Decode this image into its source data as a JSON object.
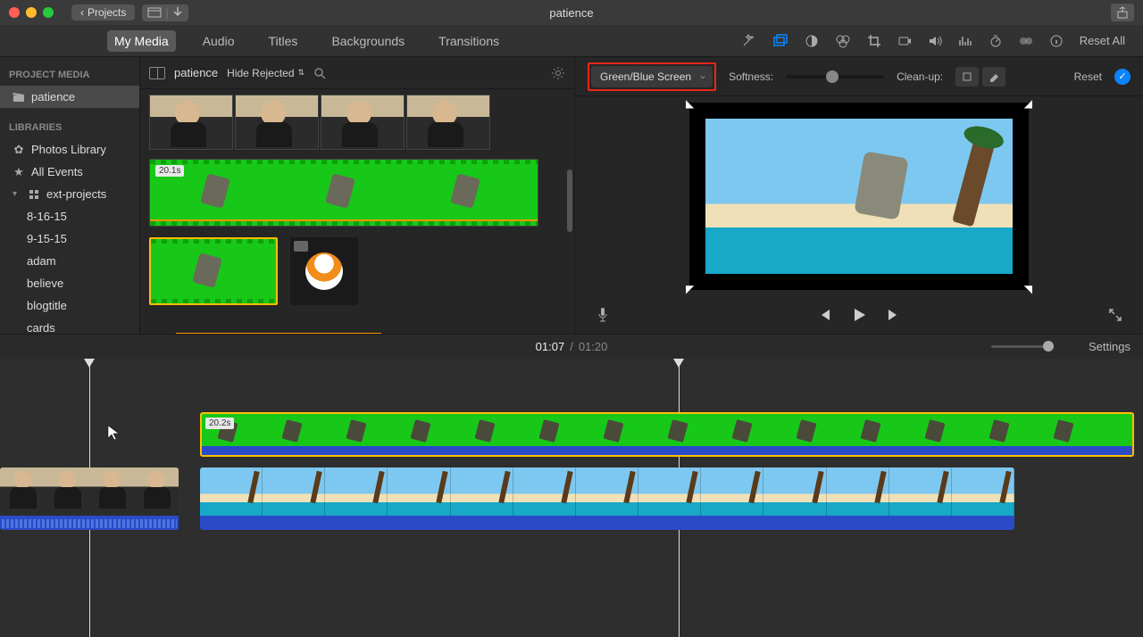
{
  "titlebar": {
    "projects_label": "Projects",
    "title": "patience"
  },
  "tabs": {
    "my_media": "My Media",
    "audio": "Audio",
    "titles": "Titles",
    "backgrounds": "Backgrounds",
    "transitions": "Transitions",
    "reset_all": "Reset All"
  },
  "sidebar": {
    "project_media_hdr": "PROJECT MEDIA",
    "project_name": "patience",
    "libraries_hdr": "LIBRARIES",
    "photos_library": "Photos Library",
    "all_events": "All Events",
    "ext_projects": "ext-projects",
    "events": {
      "e1": "8-16-15",
      "e2": "9-15-15",
      "e3": "adam",
      "e4": "believe",
      "e5": "blogtitle",
      "e6": "cards"
    }
  },
  "browser": {
    "name": "patience",
    "hide_rejected": "Hide Rejected",
    "clip1_duration": "20.1s"
  },
  "overlay": {
    "mode": "Green/Blue Screen",
    "softness_label": "Softness:",
    "cleanup_label": "Clean-up:",
    "reset": "Reset"
  },
  "time": {
    "current": "01:07",
    "sep": "/",
    "duration": "01:20",
    "settings": "Settings"
  },
  "timeline": {
    "overlay_duration": "20.2s"
  }
}
